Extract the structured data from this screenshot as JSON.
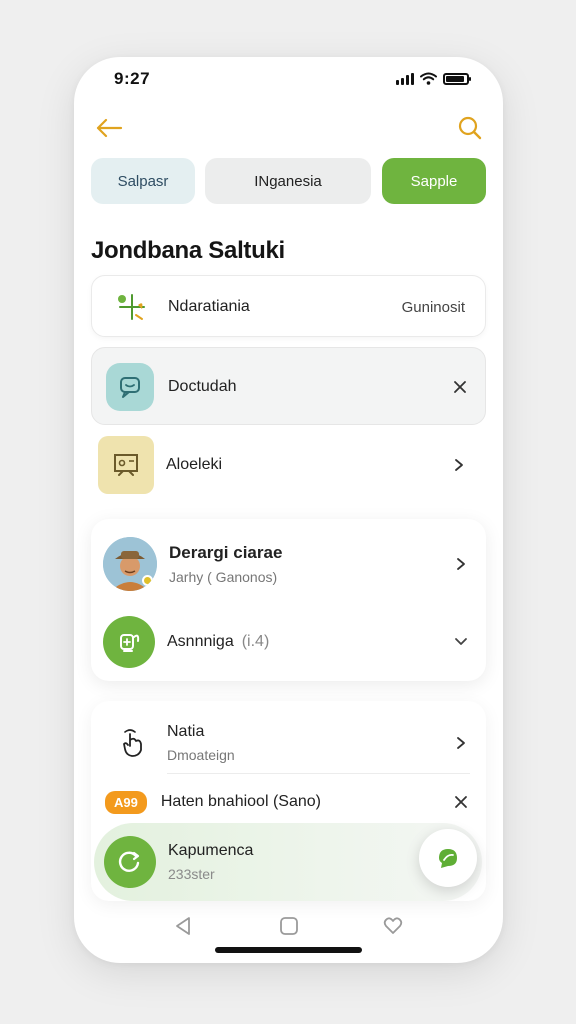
{
  "status": {
    "time": "9:27"
  },
  "chips": [
    {
      "label": "Salpasr"
    },
    {
      "label": "INganesia"
    },
    {
      "label": "Sapple"
    }
  ],
  "section": {
    "title": "Jondbana Saltuki"
  },
  "rows": {
    "a": {
      "title": "Ndaratiania",
      "right": "Guninosit"
    },
    "b": {
      "title": "Doctudah"
    },
    "c": {
      "title": "Aloeleki"
    },
    "d1": {
      "title": "Derargi ciarae",
      "sub": "Jarhy ( Ganonos)"
    },
    "d2": {
      "title": "Asnnniga",
      "extra": "(i.4)"
    },
    "e1": {
      "title": "Natia",
      "sub": "Dmoateign"
    },
    "e2": {
      "badge": "A99",
      "title": "Haten bnahiool (Sano)"
    },
    "e3": {
      "title": "Kapumenca",
      "sub": "233ster"
    }
  },
  "colors": {
    "accent": "#6fb43f",
    "icon_gold": "#e0a31f",
    "badge": "#f39a1d"
  }
}
